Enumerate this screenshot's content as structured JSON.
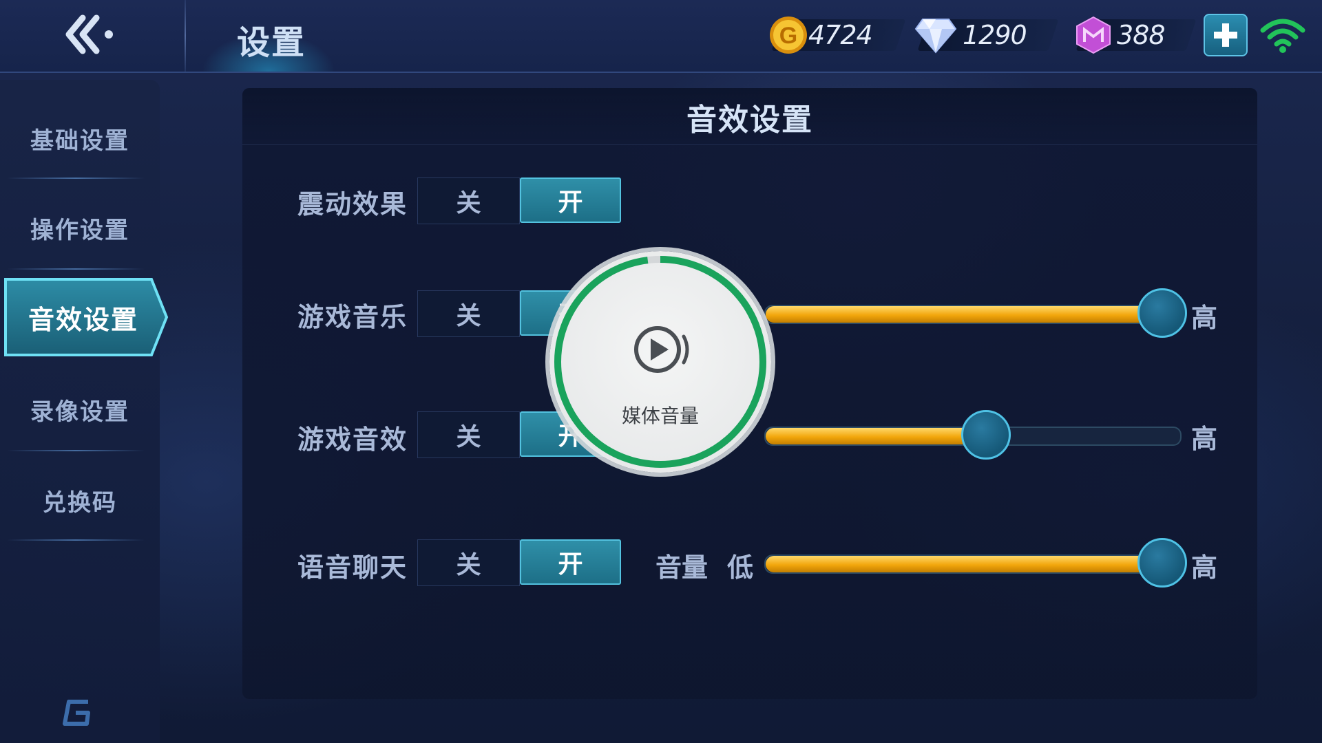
{
  "header": {
    "title": "设置",
    "currencies": [
      {
        "name": "gold",
        "value": "4724",
        "color": "#f2b51d"
      },
      {
        "name": "diamond",
        "value": "1290",
        "color": "#c8d8ff"
      },
      {
        "name": "gem",
        "value": "388",
        "color": "#c64fd8"
      }
    ],
    "icons": {
      "back": "back-chevrons-icon",
      "add": "plus-icon",
      "signal": "wifi-icon"
    }
  },
  "sidebar": {
    "items": [
      {
        "label": "基础设置"
      },
      {
        "label": "操作设置"
      },
      {
        "label": "音效设置",
        "active": true
      },
      {
        "label": "录像设置"
      },
      {
        "label": "兑换码"
      }
    ]
  },
  "panel": {
    "title": "音效设置",
    "rows": [
      {
        "label": "震动效果",
        "off": "关",
        "on": "开",
        "state": "on"
      },
      {
        "label": "游戏音乐",
        "off": "关",
        "on": "开",
        "state": "on",
        "level": 0.98,
        "high": "高"
      },
      {
        "label": "游戏音效",
        "off": "关",
        "on": "开",
        "state": "on",
        "level": 0.54,
        "high": "高"
      },
      {
        "label": "语音聊天",
        "off": "关",
        "on": "开",
        "state": "on",
        "volume_label": "音量",
        "low": "低",
        "level": 0.98,
        "high": "高"
      }
    ]
  },
  "overlay": {
    "label": "媒体音量",
    "icon": "media-volume-icon",
    "progress": 0.98,
    "ring_color": "#1aa35c"
  },
  "colors": {
    "accent": "#53c2df",
    "slider_fill": "#f2a60c"
  }
}
